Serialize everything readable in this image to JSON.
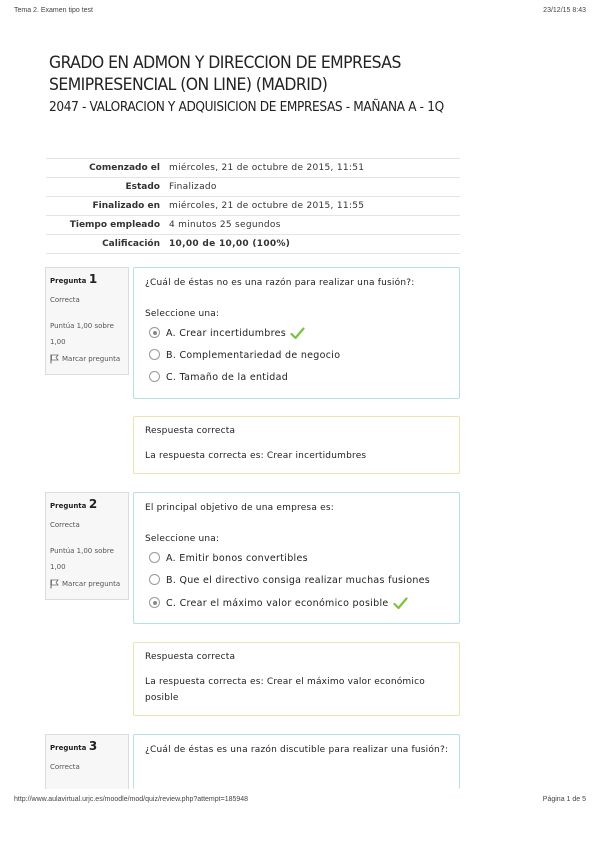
{
  "print_header": {
    "title": "Tema 2. Examen tipo test",
    "datetime": "23/12/15 8:43"
  },
  "print_footer": {
    "url": "http://www.aulavirtual.urjc.es/moodle/mod/quiz/review.php?attempt=185948",
    "page": "Página 1 de 5"
  },
  "course": {
    "title": "GRADO EN ADMON Y DIRECCION DE EMPRESAS SEMIPRESENCIAL (ON LINE) (MADRID)",
    "subject": "2047 - VALORACION Y ADQUISICION DE EMPRESAS - MAÑANA A - 1Q"
  },
  "summary": [
    {
      "label": "Comenzado el",
      "value": "miércoles, 21 de octubre de 2015, 11:51"
    },
    {
      "label": "Estado",
      "value": "Finalizado"
    },
    {
      "label": "Finalizado en",
      "value": "miércoles, 21 de octubre de 2015, 11:55"
    },
    {
      "label": "Tiempo empleado",
      "value": "4 minutos 25 segundos"
    },
    {
      "label": "Calificación",
      "value": "10,00 de 10,00 (100%)"
    }
  ],
  "questions": [
    {
      "prefix": "Pregunta",
      "number": "1",
      "state": "Correcta",
      "grade": "Puntúa 1,00 sobre 1,00",
      "flag_label": "Marcar pregunta",
      "text": "¿Cuál de éstas no es una razón para realizar una fusión?:",
      "select_label": "Seleccione una:",
      "options": [
        "A. Crear incertidumbres",
        "B. Complementariedad de negocio",
        "C. Tamaño de la entidad"
      ],
      "selected": 0,
      "feedback_title": "Respuesta correcta",
      "feedback_text": "La respuesta correcta es: Crear incertidumbres"
    },
    {
      "prefix": "Pregunta",
      "number": "2",
      "state": "Correcta",
      "grade": "Puntúa 1,00 sobre 1,00",
      "flag_label": "Marcar pregunta",
      "text": "El principal objetivo de una empresa es:",
      "select_label": "Seleccione una:",
      "options": [
        "A. Emitir bonos convertibles",
        "B. Que el directivo consiga realizar muchas fusiones",
        "C. Crear el máximo valor económico posible"
      ],
      "selected": 2,
      "feedback_title": "Respuesta correcta",
      "feedback_text": "La respuesta correcta es: Crear el máximo valor económico posible"
    },
    {
      "prefix": "Pregunta",
      "number": "3",
      "state": "Correcta",
      "text": "¿Cuál de éstas es una razón discutible para realizar una fusión?:"
    }
  ],
  "colors": {
    "question_border": "#b7dde6",
    "feedback_border": "#f1e1b0",
    "check": "#7cc242"
  }
}
